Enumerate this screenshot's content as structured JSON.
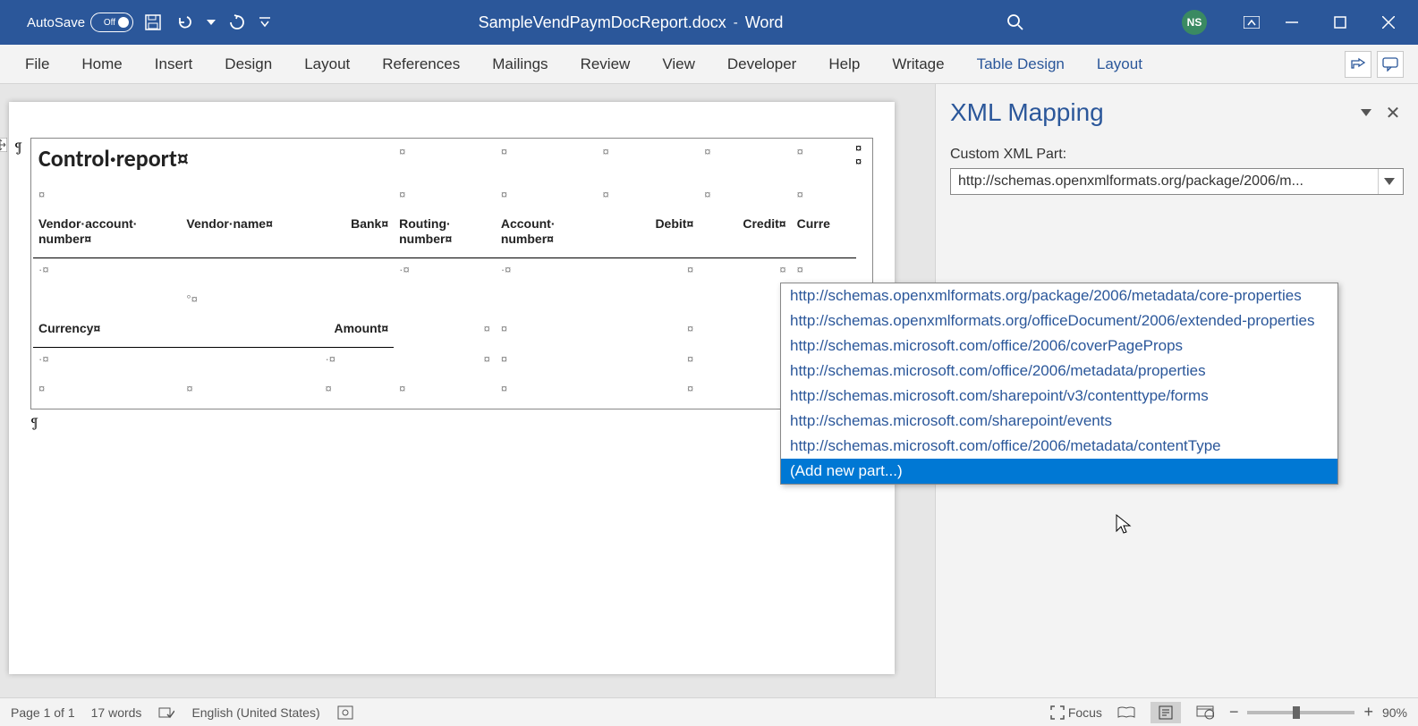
{
  "titlebar": {
    "autosave_label": "AutoSave",
    "autosave_state": "Off",
    "doc_name": "SampleVendPaymDocReport.docx",
    "app_name": "Word",
    "user_initials": "NS"
  },
  "ribbon": {
    "tabs": [
      "File",
      "Home",
      "Insert",
      "Design",
      "Layout",
      "References",
      "Mailings",
      "Review",
      "View",
      "Developer",
      "Help",
      "Writage"
    ],
    "context_tabs": [
      "Table Design",
      "Layout"
    ]
  },
  "document": {
    "title": "Control·report¤",
    "headers_row1": [
      "Vendor·account·",
      "",
      "",
      "Routing·",
      "Account·",
      "",
      "",
      ""
    ],
    "headers_row2": [
      "number¤",
      "Vendor·name¤",
      "Bank¤",
      "number¤",
      "number¤",
      "Debit¤",
      "Credit¤",
      "Curre"
    ],
    "sub_headers": [
      "Currency¤",
      "",
      "Amount¤",
      "",
      "",
      "",
      "",
      ""
    ]
  },
  "pane": {
    "title": "XML Mapping",
    "label": "Custom XML Part:",
    "selected": "http://schemas.openxmlformats.org/package/2006/m...",
    "options": [
      "http://schemas.openxmlformats.org/package/2006/metadata/core-properties",
      "http://schemas.openxmlformats.org/officeDocument/2006/extended-properties",
      "http://schemas.microsoft.com/office/2006/coverPageProps",
      "http://schemas.microsoft.com/office/2006/metadata/properties",
      "http://schemas.microsoft.com/sharepoint/v3/contenttype/forms",
      "http://schemas.microsoft.com/sharepoint/events",
      "http://schemas.microsoft.com/office/2006/metadata/contentType"
    ],
    "add_new": "(Add new part...)"
  },
  "statusbar": {
    "page": "Page 1 of 1",
    "words": "17 words",
    "language": "English (United States)",
    "focus": "Focus",
    "zoom": "90%"
  }
}
